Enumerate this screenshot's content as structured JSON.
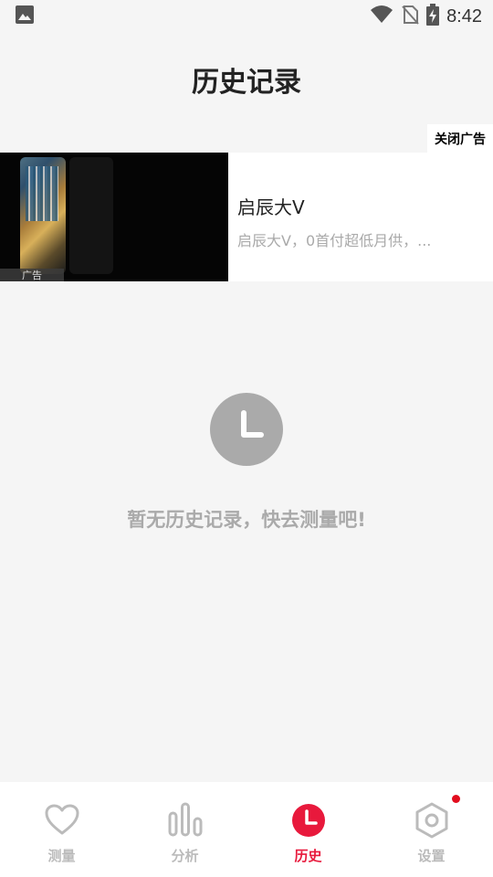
{
  "status_bar": {
    "time": "8:42",
    "icons": [
      "image-icon",
      "wifi-icon",
      "no-sim-icon",
      "battery-charging-icon"
    ]
  },
  "header": {
    "title": "历史记录"
  },
  "ad": {
    "close_label": "关闭广告",
    "tag": "广告",
    "title": "启辰大V",
    "description": "启辰大V，0首付超低月供，..."
  },
  "empty_state": {
    "icon": "clock-icon",
    "message": "暂无历史记录，快去测量吧!"
  },
  "bottom_nav": {
    "items": [
      {
        "label": "测量",
        "icon": "heart-icon",
        "active": false
      },
      {
        "label": "分析",
        "icon": "bar-chart-icon",
        "active": false
      },
      {
        "label": "历史",
        "icon": "clock-icon",
        "active": true
      },
      {
        "label": "设置",
        "icon": "hexagon-settings-icon",
        "active": false,
        "badge": true
      }
    ]
  },
  "colors": {
    "accent": "#e8193c",
    "inactive": "#bbbbbb",
    "background": "#f5f5f5",
    "badge": "#e20d1e"
  }
}
